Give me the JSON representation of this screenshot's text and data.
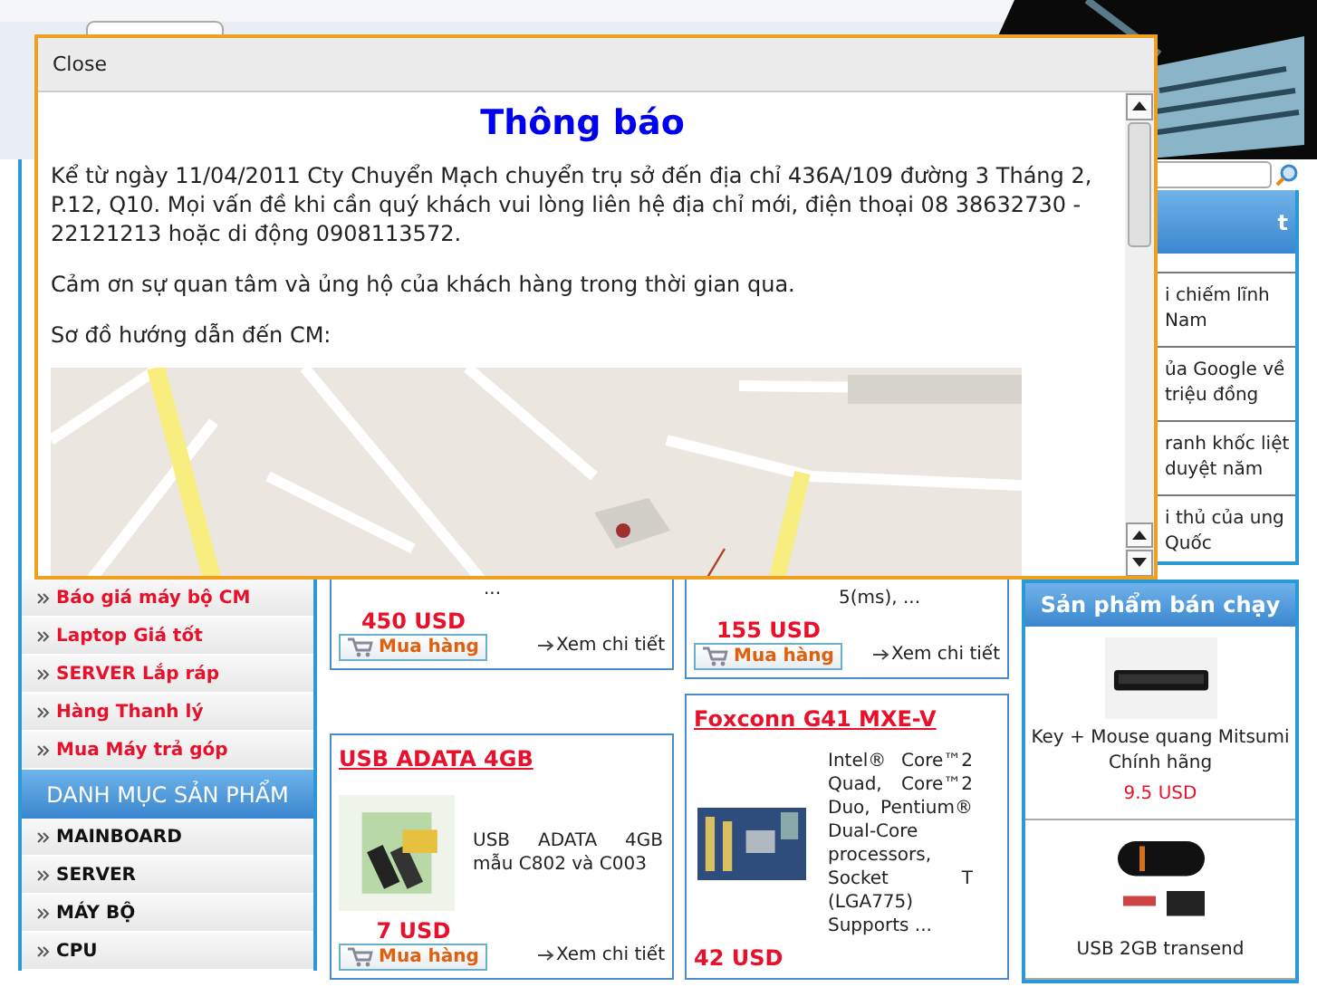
{
  "modal": {
    "close": "Close",
    "title": "Thông báo",
    "paragraphs": [
      "Kể từ ngày 11/04/2011 Cty Chuyển Mạch chuyển trụ sở đến địa chỉ 436A/109 đường 3 Tháng 2, P.12, Q10. Mọi vấn đề khi cần quý khách vui lòng liên hệ địa chỉ mới, điện thoại 08 38632730 - 22121213  hoặc di động 0908113572.",
      "Cảm ơn sự quan tâm và ủng hộ của khách hàng trong thời gian qua.",
      "Sơ đồ hướng dẫn đến CM:"
    ]
  },
  "news": {
    "heading": "t",
    "items": [
      "i chiếm lĩnh Nam",
      "ủa Google về triệu đồng",
      "ranh khốc liệt duyệt năm",
      "i thủ của ung Quốc"
    ]
  },
  "sidebar": {
    "promo_items": [
      "Báo giá máy bộ CM",
      "Laptop Giá tốt",
      "SERVER Lắp ráp",
      "Hàng Thanh lý",
      "Mua Máy trả góp"
    ],
    "category_heading": "DANH MỤC SẢN PHẨM",
    "categories": [
      "MAINBOARD",
      "SERVER",
      "MÁY BỘ",
      "CPU"
    ]
  },
  "product_columns": [
    [
      {
        "description": "...",
        "price": "450 USD",
        "buy": "Mua hàng",
        "details": "Xem chi tiết"
      },
      {
        "title": "USB ADATA 4GB",
        "description": "USB ADATA 4GB mẫu C802 và C003",
        "price": "7 USD",
        "buy": "Mua hàng",
        "details": "Xem chi tiết"
      }
    ],
    [
      {
        "description": "5(ms),  ...",
        "price": "155 USD",
        "buy": "Mua hàng",
        "details": "Xem chi tiết"
      },
      {
        "title": "Foxconn G41 MXE-V",
        "description": "Intel® Core™2 Quad, Core™2 Duo, Pentium® Dual-Core processors, Socket T (LGA775) Supports ...",
        "price": "42 USD"
      }
    ]
  ],
  "bestsellers": {
    "heading": "Sản phẩm bán chạy",
    "items": [
      {
        "name": "Key + Mouse quang Mitsumi Chính hãng",
        "price": "9.5 USD"
      },
      {
        "name": "USB 2GB transend"
      }
    ]
  }
}
